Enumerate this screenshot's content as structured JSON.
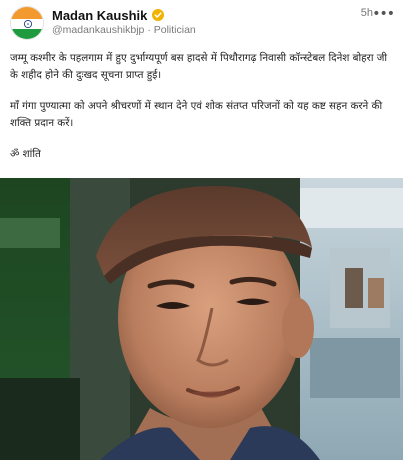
{
  "post": {
    "author_name": "Madan Kaushik",
    "author_handle": "@madankaushikbjp",
    "author_role": "Politician",
    "separator": "·",
    "time": "5h",
    "more_icon": "more-horizontal-icon",
    "verified_icon": "verified-badge-icon",
    "paragraphs": [
      "जम्मू कश्मीर के पहलगाम में हुए दुर्भाग्यपूर्ण बस हादसे में पिथौरागढ़ निवासी कॉन्स्टेबल दिनेश बोहरा जी के शहीद होने की दुःखद सूचना प्राप्त हुई।",
      "माँ गंगा पुण्यात्मा को अपने श्रीचरणों में स्थान देने एवं शोक संतप्त परिजनों को यह कष्ट सहन करने की शक्ति प्रदान करें।",
      "ॐ शांति"
    ]
  },
  "colors": {
    "flag_saffron": "#f39a2e",
    "flag_green": "#1f9a3e",
    "flag_chakra": "#1d3f8f",
    "verified": "#f2b200"
  }
}
